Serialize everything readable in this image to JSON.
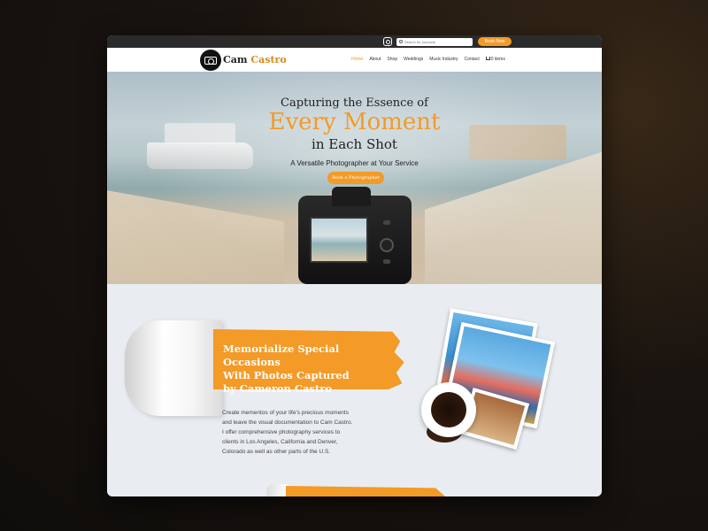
{
  "topbar": {
    "search_placeholder": "Search for products",
    "book_now_label": "Book Now"
  },
  "nav": {
    "logo": {
      "first": "Cam",
      "second": "Castro"
    },
    "links": [
      "Home",
      "About",
      "Shop",
      "Weddings",
      "Music Industry",
      "Contact"
    ],
    "cart_label": "0 items",
    "active_link": "Home"
  },
  "hero": {
    "title_line1": "Capturing the Essence of",
    "title_line2": "Every Moment",
    "title_line3": "in Each Shot",
    "subtitle": "A Versatile Photographer at Your Service",
    "cta_label": "Book a Photographer"
  },
  "section": {
    "banner_line1": "Memorialize Special Occasions",
    "banner_line2": "With Photos Captured",
    "banner_line3": "by Cameron Castro",
    "body": "Create mementos of your life's precious moments and leave the visual documentation to Cam Castro. I offer comprehensive photography services to clients in Los Angeles, California and Denver, Colorado as well as other parts of the U.S."
  },
  "colors": {
    "accent": "#f39a27",
    "dark": "#2b2b2b",
    "background": "#e9edf1"
  },
  "icons": [
    "instagram-icon",
    "search-icon",
    "camera-logo-icon",
    "cart-icon"
  ]
}
